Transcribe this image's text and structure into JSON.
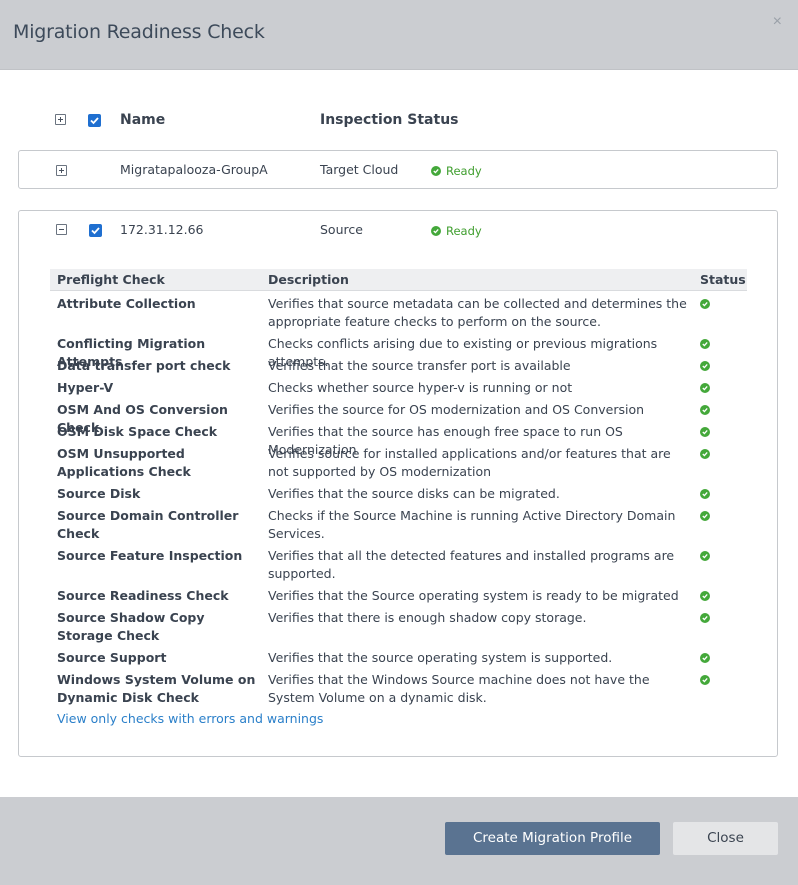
{
  "dialog": {
    "title": "Migration Readiness Check",
    "close_symbol": "×"
  },
  "columns": {
    "name": "Name",
    "inspection_status": "Inspection Status"
  },
  "groups": [
    {
      "name": "Migratapalooza-GroupA",
      "type": "Target Cloud",
      "status": "Ready",
      "expanded": false,
      "checked": false
    },
    {
      "name": "172.31.12.66",
      "type": "Source",
      "status": "Ready",
      "expanded": true,
      "checked": true
    }
  ],
  "preflight": {
    "headers": {
      "check": "Preflight Check",
      "description": "Description",
      "status": "Status"
    },
    "rows": [
      {
        "check": "Attribute Collection",
        "description": "Verifies that source metadata can be collected and determines the appropriate feature checks to perform on the source.",
        "status": "ok"
      },
      {
        "check": "Conflicting Migration Attempts",
        "description": "Checks conflicts arising due to existing or previous migrations attempts.",
        "status": "ok"
      },
      {
        "check": "Data transfer port check",
        "description": "Verifies that the source transfer port is available",
        "status": "ok"
      },
      {
        "check": "Hyper-V",
        "description": "Checks whether source hyper-v is running or not",
        "status": "ok"
      },
      {
        "check": "OSM And OS Conversion Check",
        "description": "Verifies the source for OS modernization and OS Conversion",
        "status": "ok"
      },
      {
        "check": "OSM Disk Space Check",
        "description": "Verifies that the source has enough free space to run OS Modernization",
        "status": "ok"
      },
      {
        "check": "OSM Unsupported Applications Check",
        "description": "Verifies source for installed applications and/or features that are not supported by OS modernization",
        "status": "ok"
      },
      {
        "check": "Source Disk",
        "description": "Verifies that the source disks can be migrated.",
        "status": "ok"
      },
      {
        "check": "Source Domain Controller Check",
        "description": "Checks if the Source Machine is running Active Directory Domain Services.",
        "status": "ok"
      },
      {
        "check": "Source Feature Inspection",
        "description": "Verifies that all the detected features and installed programs are supported.",
        "status": "ok"
      },
      {
        "check": "Source Readiness Check",
        "description": "Verifies that the Source operating system is ready to be migrated",
        "status": "ok"
      },
      {
        "check": "Source Shadow Copy Storage Check",
        "description": "Verifies that there is enough shadow copy storage.",
        "status": "ok"
      },
      {
        "check": "Source Support",
        "description": "Verifies that the source operating system is supported.",
        "status": "ok"
      },
      {
        "check": "Windows System Volume on Dynamic Disk Check",
        "description": "Verifies that the Windows Source machine does not have the System Volume on a dynamic disk.",
        "status": "ok"
      }
    ],
    "filter_link": "View only checks with errors and warnings"
  },
  "footer": {
    "primary_label": "Create Migration Profile",
    "secondary_label": "Close"
  },
  "colors": {
    "accent_blue": "#1f6fd0",
    "ready_green": "#44a83a",
    "link_blue": "#2a7fc9",
    "primary_button": "#5a7391"
  }
}
